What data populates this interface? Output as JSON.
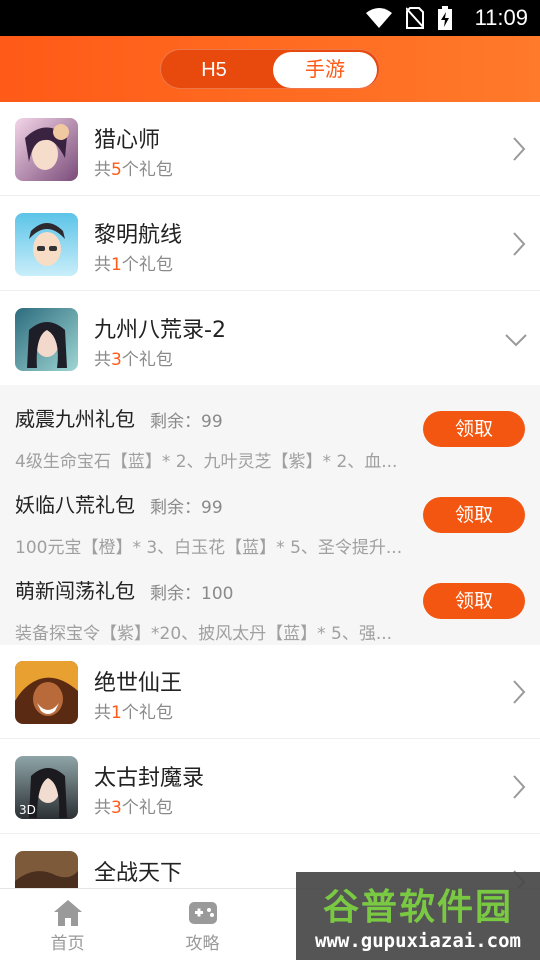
{
  "status_bar": {
    "time": "11:09",
    "icons": [
      "wifi-icon",
      "no-sim-icon",
      "battery-charging-icon"
    ]
  },
  "header": {
    "tabs": [
      {
        "label": "H5",
        "active": false
      },
      {
        "label": "手游",
        "active": true
      }
    ],
    "accent_color": "#ff5a17"
  },
  "games": [
    {
      "name": "猎心师",
      "count_prefix": "共",
      "count": "5",
      "count_suffix": "个礼包",
      "expanded": false
    },
    {
      "name": "黎明航线",
      "count_prefix": "共",
      "count": "1",
      "count_suffix": "个礼包",
      "expanded": false
    },
    {
      "name": "九州八荒录-2",
      "count_prefix": "共",
      "count": "3",
      "count_suffix": "个礼包",
      "expanded": true
    },
    {
      "name": "绝世仙王",
      "count_prefix": "共",
      "count": "1",
      "count_suffix": "个礼包",
      "expanded": false
    },
    {
      "name": "太古封魔录",
      "count_prefix": "共",
      "count": "3",
      "count_suffix": "个礼包",
      "expanded": false
    },
    {
      "name": "全战天下",
      "count_prefix": "",
      "count": "",
      "count_suffix": "",
      "expanded": false
    }
  ],
  "gifts": [
    {
      "name": "威震九州礼包",
      "remain": "剩余：99",
      "desc": "4级生命宝石【蓝】* 2、九叶灵芝【紫】* 2、血...",
      "button": "领取"
    },
    {
      "name": "妖临八荒礼包",
      "remain": "剩余：99",
      "desc": "100元宝【橙】* 3、白玉花【蓝】* 5、圣令提升...",
      "button": "领取"
    },
    {
      "name": "萌新闯荡礼包",
      "remain": "剩余：100",
      "desc": "装备探宝令【紫】*20、披风太丹【蓝】* 5、强...",
      "button": "领取"
    }
  ],
  "bottom_nav": [
    {
      "label": "首页",
      "icon": "home-icon"
    },
    {
      "label": "攻略",
      "icon": "gamepad-icon"
    }
  ],
  "watermark": {
    "title": "谷普软件园",
    "url": "www.gupuxiazai.com"
  }
}
